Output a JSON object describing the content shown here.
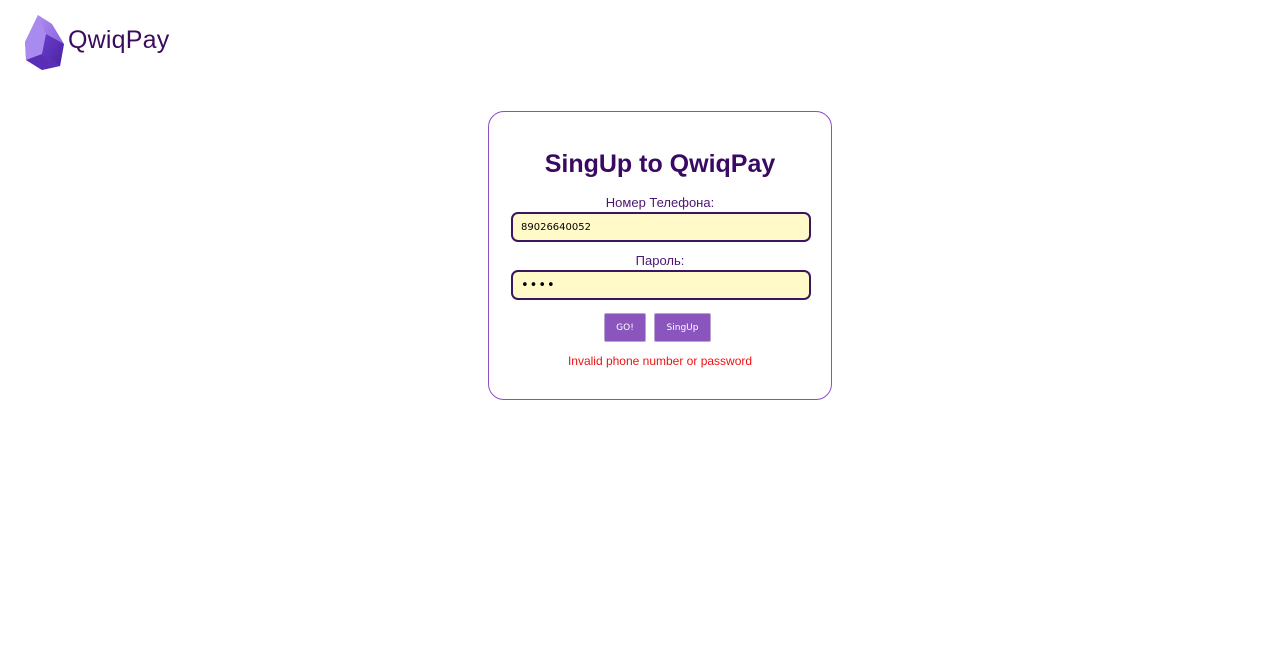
{
  "brand": {
    "name": "QwiqPay",
    "logo_icon": "crystal-logo",
    "color": "#3b0b5e"
  },
  "form": {
    "title": "SingUp to QwiqPay",
    "phone_label": "Номер Телефона:",
    "phone_value": "89026640052",
    "password_label": "Пароль:",
    "password_value": "••••",
    "go_button_label": "GO!",
    "signup_button_label": "SingUp",
    "error_message": "Invalid phone number or password"
  },
  "colors": {
    "accent": "#8a55bd",
    "input_background": "#fffac8",
    "error": "#ee1111",
    "title": "#3a0a63"
  }
}
